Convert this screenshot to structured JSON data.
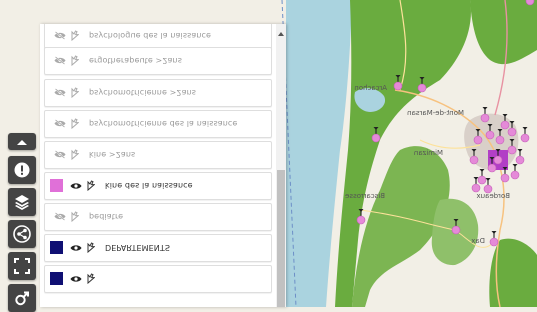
{
  "layers": [
    {
      "label": "psychologue des la naissance",
      "visible": false,
      "swatch": null,
      "partial": true
    },
    {
      "label": "ergotherapeute >2ans",
      "visible": false,
      "swatch": null
    },
    {
      "label": "psychomotricienne >2ans",
      "visible": false,
      "swatch": null
    },
    {
      "label": "psychomotricienne des la naissance",
      "visible": false,
      "swatch": null
    },
    {
      "label": "kine >2ans",
      "visible": false,
      "swatch": null
    },
    {
      "label": "kine des la naissance",
      "visible": true,
      "swatch": "#e070d8"
    },
    {
      "label": "pediatre",
      "visible": false,
      "swatch": null
    },
    {
      "label": "DEPARTEMENTS",
      "visible": true,
      "swatch": "#0f0f73"
    },
    {
      "label": "",
      "visible": true,
      "swatch": "#0f0f73",
      "partial": true
    }
  ],
  "map_places": [
    "Arcachon",
    "Biscarrosse",
    "Mimizan",
    "Dax",
    "Mont-de-Marsan",
    "Bordeaux"
  ],
  "tools": [
    {
      "name": "collapse",
      "icon": "chevron-up-icon"
    },
    {
      "name": "info",
      "icon": "exclamation-icon"
    },
    {
      "name": "layers",
      "icon": "layers-icon"
    },
    {
      "name": "share",
      "icon": "share-icon"
    },
    {
      "name": "fullscreen",
      "icon": "fullscreen-icon"
    },
    {
      "name": "measure",
      "icon": "gender-icon"
    }
  ],
  "colors": {
    "marker": "#e58ad8",
    "marker_cluster": "#b23fc6",
    "forest": "#6aac3f",
    "sea": "#aad3df",
    "departement_line": "#0f0f73"
  }
}
